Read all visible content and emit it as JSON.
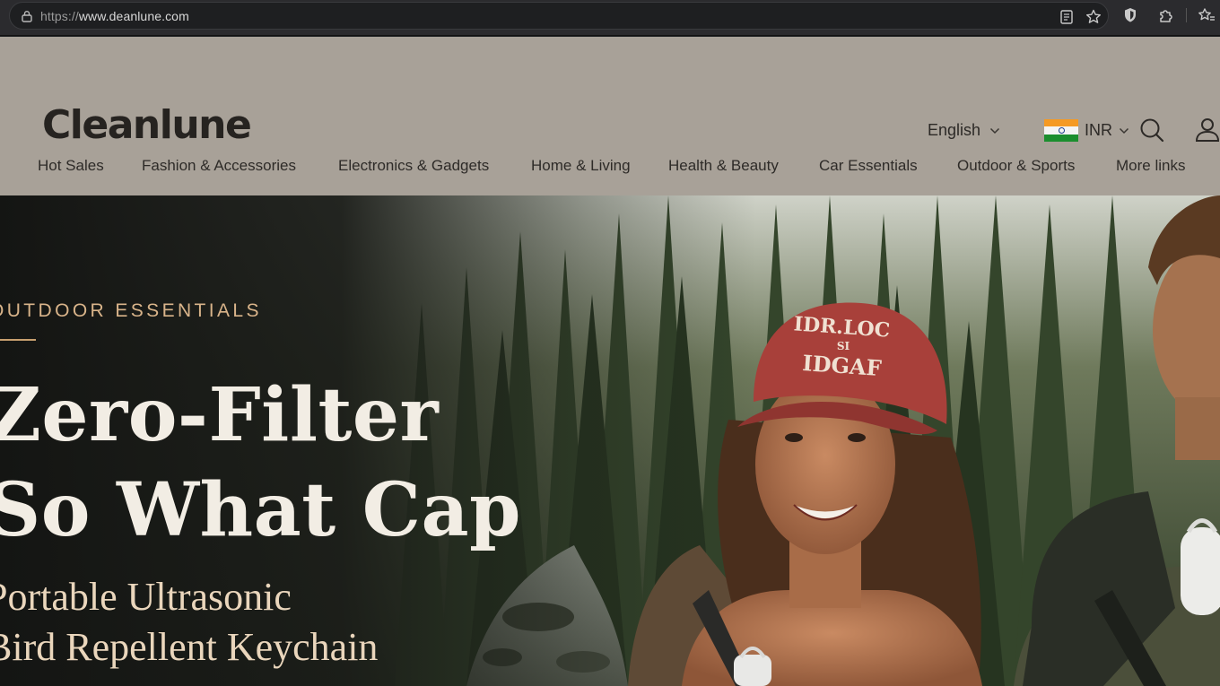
{
  "browser": {
    "url_protocol": "https://",
    "url_host": "www.deanlune.com",
    "icons": [
      "lock-icon",
      "reader-mode-icon",
      "bookmark-star-icon",
      "shield-icon",
      "extensions-icon",
      "favorites-icon"
    ]
  },
  "header": {
    "logo_text": "Cleanlune",
    "language": "English",
    "currency": "INR",
    "icons": [
      "chevron-down-icon",
      "india-flag-icon",
      "search-icon",
      "account-icon"
    ]
  },
  "nav": {
    "items": [
      {
        "label": "Hot Sales"
      },
      {
        "label": "Fashion & Accessories"
      },
      {
        "label": "Electronics & Gadgets"
      },
      {
        "label": "Home & Living"
      },
      {
        "label": "Health & Beauty"
      },
      {
        "label": "Car Essentials"
      },
      {
        "label": "Outdoor & Sports"
      },
      {
        "label": "More links"
      }
    ]
  },
  "hero": {
    "eyebrow": "OUTDOOR ESSENTIALS",
    "title_line1": "Zero-Filter",
    "title_line2": "So What Cap",
    "subtitle_line1": "Portable Ultrasonic",
    "subtitle_line2": "Bird Repellent Keychain",
    "cap_text_line1": "IDR.LOC",
    "cap_text_line2": "SI",
    "cap_text_line3": "IDGAF"
  },
  "colors": {
    "header_bg": "#a8a198",
    "hero_accent": "#d9b48a",
    "cap_red": "#a8403a"
  }
}
